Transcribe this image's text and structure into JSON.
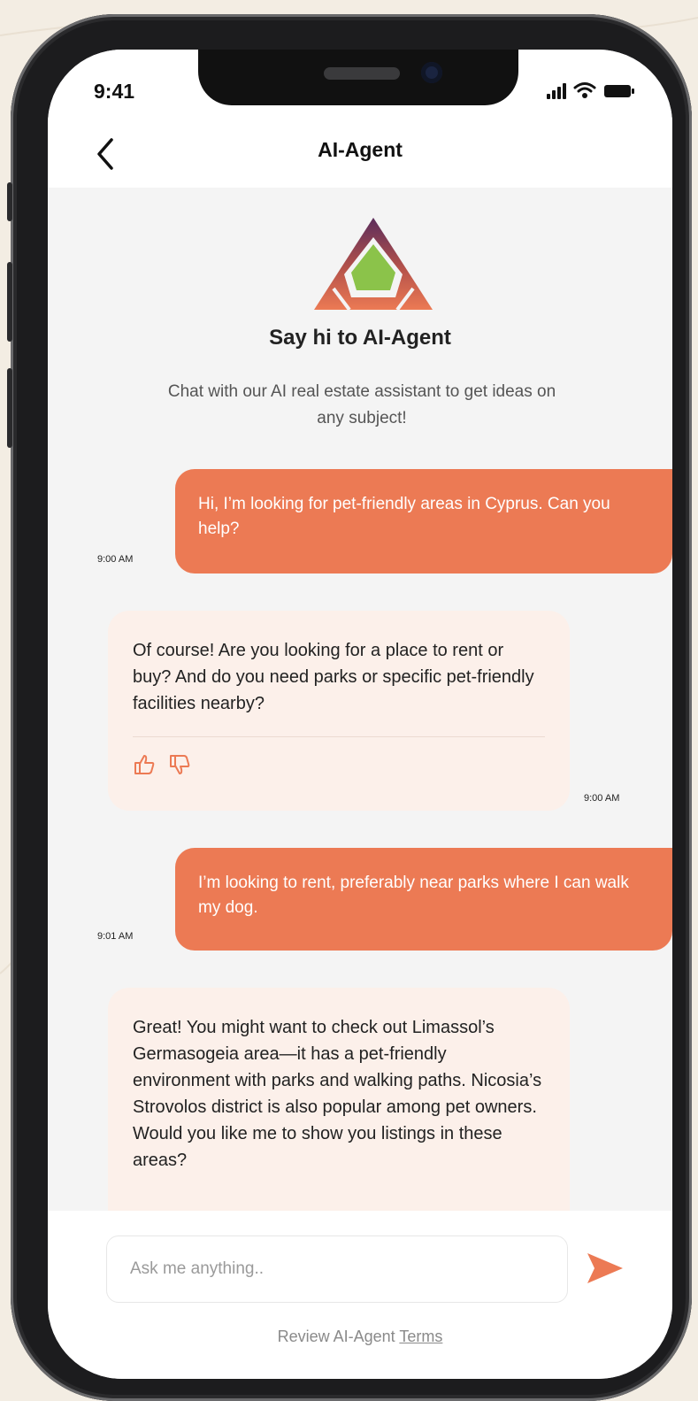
{
  "status_bar": {
    "time": "9:41"
  },
  "header": {
    "title": "AI-Agent"
  },
  "intro": {
    "title": "Say hi to AI-Agent",
    "subtitle": "Chat with our AI real estate assistant to get ideas on any subject!"
  },
  "messages": [
    {
      "sender": "user",
      "text": "Hi, I’m looking for pet-friendly areas in Cyprus. Can you help?",
      "time": "9:00 AM"
    },
    {
      "sender": "agent",
      "text": "Of course! Are you looking for a place to rent or buy? And do you need parks or specific pet-friendly facilities nearby?",
      "time": "9:00 AM"
    },
    {
      "sender": "user",
      "text": "I’m looking to rent, preferably near parks where I can walk my dog.",
      "time": "9:01 AM"
    },
    {
      "sender": "agent",
      "text": "Great! You might want to check out Limassol’s Germasogeia area—it has a pet-friendly environment with parks and walking paths. Nicosia’s Strovolos district is also popular among pet owners. Would you like me to show you listings in these areas?",
      "time": ""
    }
  ],
  "composer": {
    "placeholder": "Ask me anything..",
    "terms_prefix": "Review AI-Agent",
    "terms_link": "Terms"
  },
  "colors": {
    "accent": "#ec7a54",
    "agent_bubble": "#fcf0ea",
    "chat_bg": "#f4f4f4",
    "logo_top": "#5b2d5c",
    "logo_bottom": "#ec7a54",
    "logo_center": "#8bc34a"
  },
  "icons": {
    "back": "chevron-left-icon",
    "signal": "signal-icon",
    "wifi": "wifi-icon",
    "battery": "battery-icon",
    "logo": "ai-agent-logo",
    "thumbs_up": "thumbs-up-icon",
    "thumbs_down": "thumbs-down-icon",
    "send": "send-icon"
  }
}
